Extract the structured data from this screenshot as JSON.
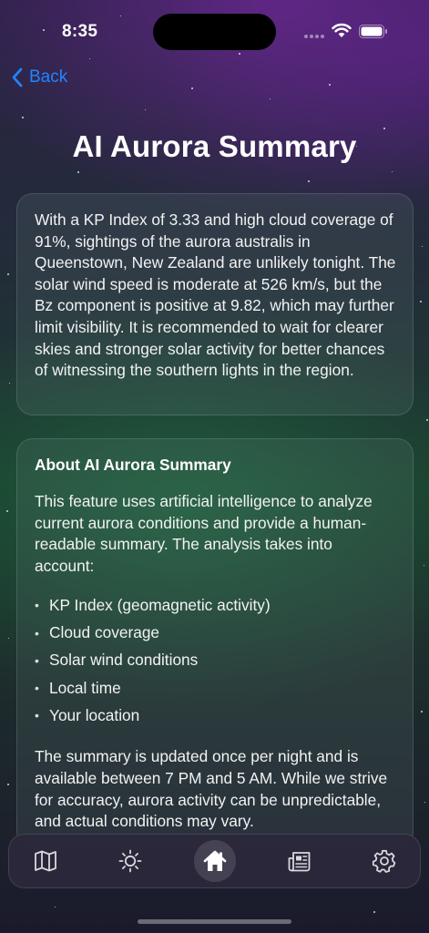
{
  "status_bar": {
    "time": "8:35"
  },
  "nav": {
    "back_label": "Back"
  },
  "page": {
    "title": "AI Aurora Summary"
  },
  "summary": {
    "text": "With a KP Index of 3.33 and high cloud coverage of 91%, sightings of the aurora australis in Queenstown, New Zealand are unlikely tonight. The solar wind speed is moderate at 526 km/s, but the Bz component is positive at 9.82, which may further limit visibility. It is recommended to wait for clearer skies and stronger solar activity for better chances of witnessing the southern lights in the region."
  },
  "about": {
    "heading": "About AI Aurora Summary",
    "intro": "This feature uses artificial intelligence to analyze current aurora conditions and provide a human-readable summary. The analysis takes into account:",
    "factors": [
      "KP Index (geomagnetic activity)",
      "Cloud coverage",
      "Solar wind conditions",
      "Local time",
      "Your location"
    ],
    "footer": "The summary is updated once per night and is available between 7 PM and 5 AM. While we strive for accuracy, aurora activity can be unpredictable, and actual conditions may vary."
  },
  "tab_bar": {
    "tabs": [
      {
        "icon": "map-icon",
        "active": false
      },
      {
        "icon": "sun-icon",
        "active": false
      },
      {
        "icon": "home-icon",
        "active": true
      },
      {
        "icon": "news-icon",
        "active": false
      },
      {
        "icon": "gear-icon",
        "active": false
      }
    ]
  },
  "colors": {
    "accent": "#1e86ff"
  }
}
